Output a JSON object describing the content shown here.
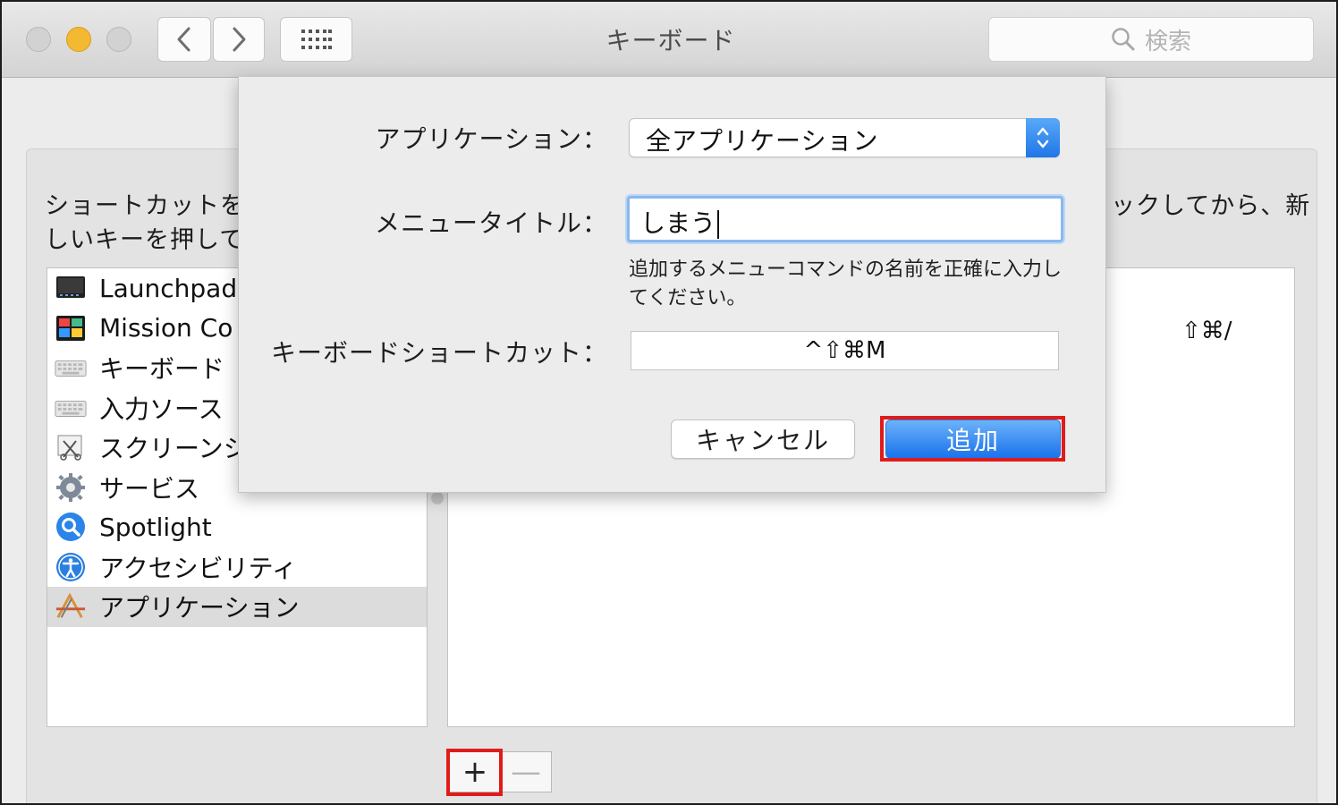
{
  "window": {
    "title": "キーボード",
    "search_placeholder": "検索"
  },
  "toolbar": {
    "back_icon": "chevron-left-icon",
    "forward_icon": "chevron-right-icon",
    "grid_icon": "grid-icon"
  },
  "instructions": {
    "left_text": "ショートカットを\nしいキーを押して",
    "right_text": "ックしてから、新"
  },
  "sidebar": {
    "items": [
      {
        "label": "Launchpad",
        "icon": "launchpad-icon"
      },
      {
        "label": "Mission Co",
        "icon": "mission-control-icon"
      },
      {
        "label": "キーボード",
        "icon": "keyboard-icon"
      },
      {
        "label": "入力ソース",
        "icon": "keyboard-icon"
      },
      {
        "label": "スクリーンシ",
        "icon": "screenshot-icon"
      },
      {
        "label": "サービス",
        "icon": "gear-icon"
      },
      {
        "label": "Spotlight",
        "icon": "spotlight-icon"
      },
      {
        "label": "アクセシビリティ",
        "icon": "accessibility-icon"
      },
      {
        "label": "アプリケーション",
        "icon": "app-shortcuts-icon",
        "selected": true
      }
    ]
  },
  "shortcut_list": {
    "visible_shortcut": "⇧⌘/"
  },
  "buttons": {
    "plus": "+",
    "minus": "—"
  },
  "dialog": {
    "application_label": "アプリケーション：",
    "application_value": "全アプリケーション",
    "menu_title_label": "メニュータイトル：",
    "menu_title_value": "しまう",
    "help_text": "追加するメニューコマンドの名前を正確に入力してください。",
    "shortcut_label": "キーボードショートカット：",
    "shortcut_value": "^⇧⌘M",
    "cancel_label": "キャンセル",
    "add_label": "追加"
  },
  "colors": {
    "accent": "#1a72ec",
    "highlight": "#e01b1b",
    "minimize": "#f4b932"
  }
}
